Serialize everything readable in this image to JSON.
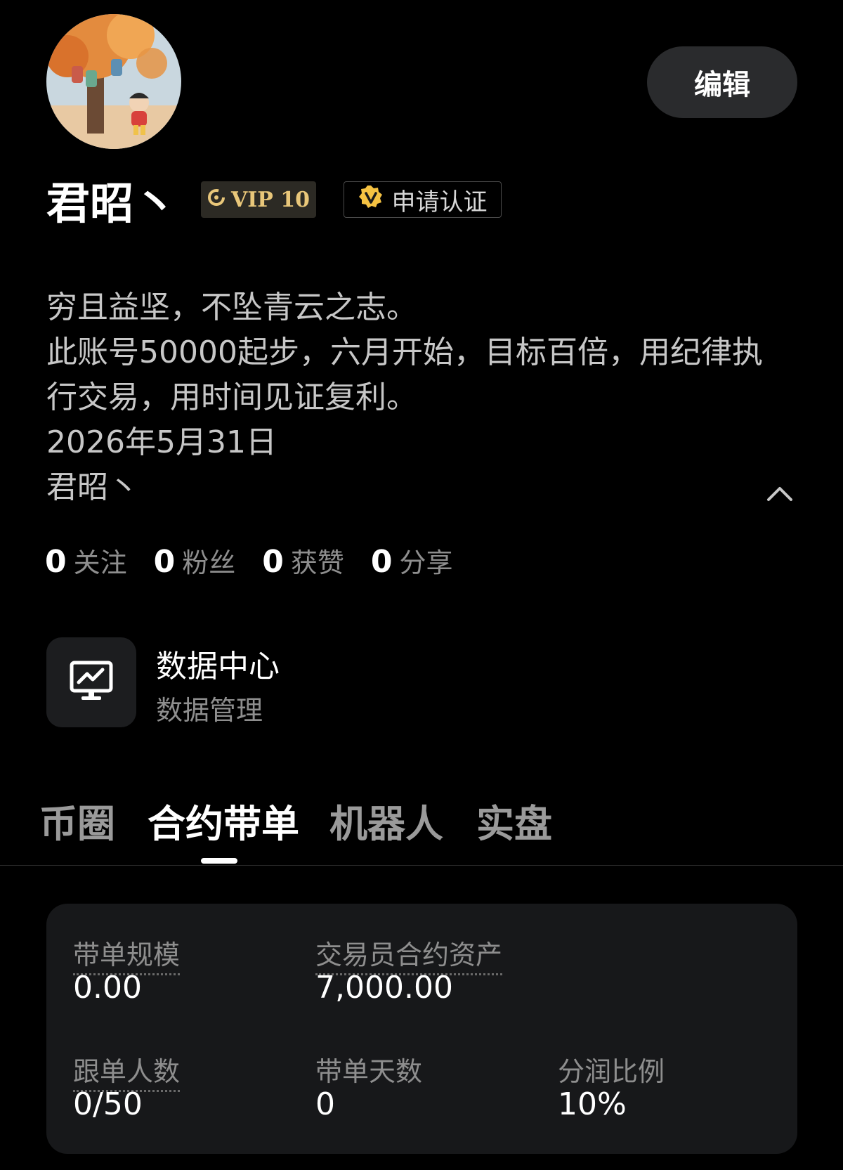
{
  "header": {
    "edit_label": "编辑"
  },
  "profile": {
    "name": "君昭丶",
    "vip_label": "VIP 10",
    "certify_label": "申请认证",
    "bio_lines": [
      "穷且益坚，不坠青云之志。",
      "此账号50000起步，六月开始，目标百倍，用纪律执",
      "行交易，用时间见证复利。",
      "2026年5月31日",
      "君昭丶"
    ]
  },
  "stats": [
    {
      "value": "0",
      "label": "关注"
    },
    {
      "value": "0",
      "label": "粉丝"
    },
    {
      "value": "0",
      "label": "获赞"
    },
    {
      "value": "0",
      "label": "分享"
    }
  ],
  "data_center": {
    "title": "数据中心",
    "subtitle": "数据管理"
  },
  "tabs": [
    {
      "label": "币圈",
      "active": false
    },
    {
      "label": "合约带单",
      "active": true
    },
    {
      "label": "机器人",
      "active": false
    },
    {
      "label": "实盘",
      "active": false
    }
  ],
  "metrics": {
    "scale": {
      "label": "带单规模",
      "value": "0.00"
    },
    "trader_assets": {
      "label": "交易员合约资产",
      "value": "7,000.00"
    },
    "followers": {
      "label": "跟单人数",
      "value": "0/50"
    },
    "days": {
      "label": "带单天数",
      "value": "0"
    },
    "profit_share": {
      "label": "分润比例",
      "value": "10%"
    }
  },
  "icons": {
    "avatar": "avatar-illustration",
    "vip": "vip-ring-icon",
    "certify": "verified-v-icon",
    "collapse": "chevron-up-icon",
    "data_center": "monitor-chart-icon"
  },
  "colors": {
    "background": "#000000",
    "vip_gold": "#e9c77a",
    "certify_gold": "#f5c242",
    "card": "#17181a"
  }
}
